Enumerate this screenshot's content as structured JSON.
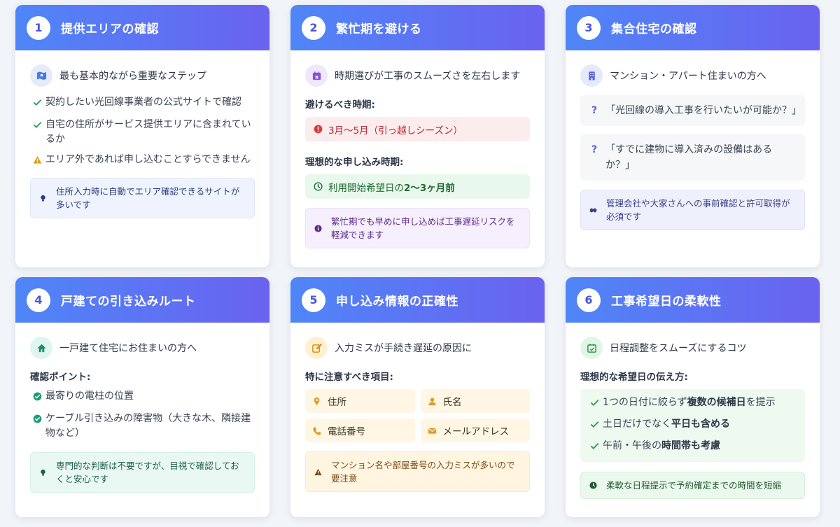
{
  "cards": [
    {
      "number": "1",
      "title": "提供エリアの確認",
      "subtitle": "最も基本的ながら重要なステップ",
      "items": [
        "契約したい光回線事業者の公式サイトで確認",
        "自宅の住所がサービス提供エリアに含まれているか",
        "エリア外であれば申し込むことすらできません"
      ],
      "note": "住所入力時に自動でエリア確認できるサイトが多いです"
    },
    {
      "number": "2",
      "title": "繁忙期を避ける",
      "subtitle": "時期選びが工事のスムーズさを左右します",
      "avoid_label": "避けるべき時期:",
      "avoid_value": "3月〜5月（引っ越しシーズン）",
      "ideal_label": "理想的な申し込み時期:",
      "ideal_prefix": "利用開始希望日の",
      "ideal_bold": "2〜3ヶ月前",
      "note": "繁忙期でも早めに申し込めば工事遅延リスクを軽減できます"
    },
    {
      "number": "3",
      "title": "集合住宅の確認",
      "subtitle": "マンション・アパート住まいの方へ",
      "questions": [
        "「光回線の導入工事を行いたいが可能か？」",
        "「すでに建物に導入済みの設備はあるか？」"
      ],
      "question_mark": "?",
      "note": "管理会社や大家さんへの事前確認と許可取得が必須です"
    },
    {
      "number": "4",
      "title": "戸建ての引き込みルート",
      "subtitle": "一戸建て住宅にお住まいの方へ",
      "points_label": "確認ポイント:",
      "items": [
        "最寄りの電柱の位置",
        "ケーブル引き込みの障害物（大きな木、隣接建物など）"
      ],
      "note": "専門的な判断は不要ですが、目視で確認しておくと安心です"
    },
    {
      "number": "5",
      "title": "申し込み情報の正確性",
      "subtitle": "入力ミスが手続き遅延の原因に",
      "fields_label": "特に注意すべき項目:",
      "fields": [
        "住所",
        "氏名",
        "電話番号",
        "メールアドレス"
      ],
      "note": "マンション名や部屋番号の入力ミスが多いので要注意"
    },
    {
      "number": "6",
      "title": "工事希望日の柔軟性",
      "subtitle": "日程調整をスムーズにするコツ",
      "tips_label": "理想的な希望日の伝え方:",
      "tips": [
        {
          "prefix": "1つの日付に絞らず",
          "bold": "複数の候補日",
          "suffix": "を提示"
        },
        {
          "prefix": "土日だけでなく",
          "bold": "平日も含める",
          "suffix": ""
        },
        {
          "prefix": "午前・午後の",
          "bold": "時間帯も考慮",
          "suffix": ""
        }
      ],
      "note": "柔軟な日程提示で予約確定までの時間を短縮"
    }
  ],
  "icons": {
    "card1_subtitle": "map-icon",
    "card2_subtitle": "calendar-x-icon",
    "card3_subtitle": "building-icon",
    "card4_subtitle": "home-icon",
    "card5_subtitle": "edit-icon",
    "card6_subtitle": "calendar-check-icon"
  },
  "colors": {
    "header_gradient_start": "#4f86f7",
    "header_gradient_end": "#6a62f0",
    "check_green": "#2e9a4e",
    "warning_amber": "#e0a00e",
    "danger_red": "#d93a3a",
    "field_orange": "#e39a1e"
  }
}
